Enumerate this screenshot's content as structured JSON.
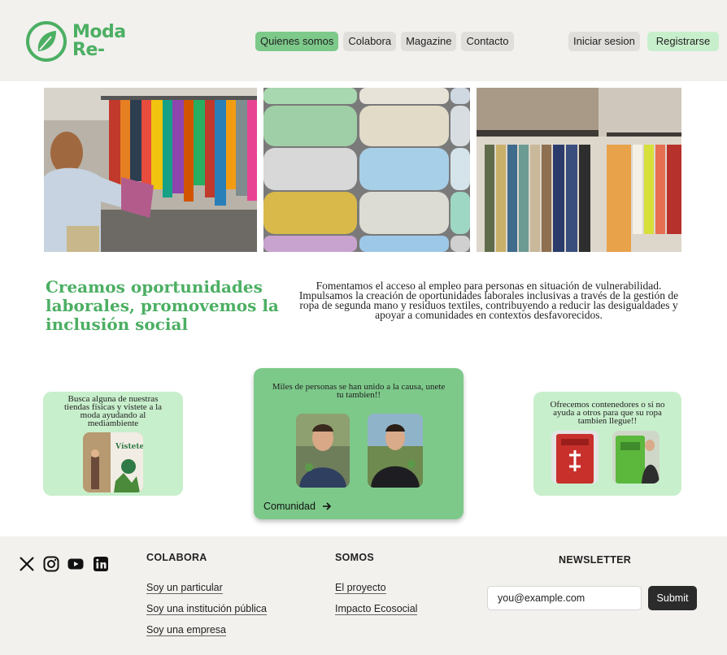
{
  "header": {
    "logo_line1": "Moda",
    "logo_line2": "Re-",
    "nav": [
      {
        "label": "Quienes somos",
        "active": true
      },
      {
        "label": "Colabora",
        "active": false
      },
      {
        "label": "Magazine",
        "active": false
      },
      {
        "label": "Contacto",
        "active": false
      }
    ],
    "login_label": "Iniciar sesion",
    "register_label": "Registrarse"
  },
  "mission": {
    "title": "Creamos oportunidades laborales, promovemos la inclusión social",
    "text": "Fomentamos el acceso al empleo para personas en situación de vulnerabilidad. Impulsamos la creación de oportunidades laborales inclusivas a través de la gestión de ropa de segunda mano y residuos textiles, contribuyendo a reducir las desigualdades y apoyar a  comunidades en contextos desfavorecidos."
  },
  "cards": {
    "stores": {
      "text": "Busca alguna de nuestras tiendas físicas y vistete a la moda ayudando al mediambiente",
      "sign_text": "Vístete cambio."
    },
    "community": {
      "text": "Miles de personas se han unido a la causa, unete tu tambien!!",
      "link_label": "Comunidad"
    },
    "containers": {
      "text": "Ofrecemos contenedores o si no ayuda a otros para que su ropa tambien llegue!!"
    }
  },
  "footer": {
    "social": [
      "x-icon",
      "instagram-icon",
      "youtube-icon",
      "linkedin-icon"
    ],
    "colabora": {
      "heading": "COLABORA",
      "links": [
        "Soy un particular",
        "Soy una institución pública",
        "Soy una empresa"
      ]
    },
    "somos": {
      "heading": "SOMOS",
      "links": [
        "El proyecto",
        "Impacto Ecosocial"
      ]
    },
    "newsletter": {
      "heading": "NEWSLETTER",
      "placeholder": "you@example.com",
      "submit_label": "Submit"
    }
  },
  "colors": {
    "brand_green": "#4caf63",
    "active_nav": "#7dc98a",
    "light_green": "#c8efcc",
    "footer_bg": "#f2f1ee"
  }
}
